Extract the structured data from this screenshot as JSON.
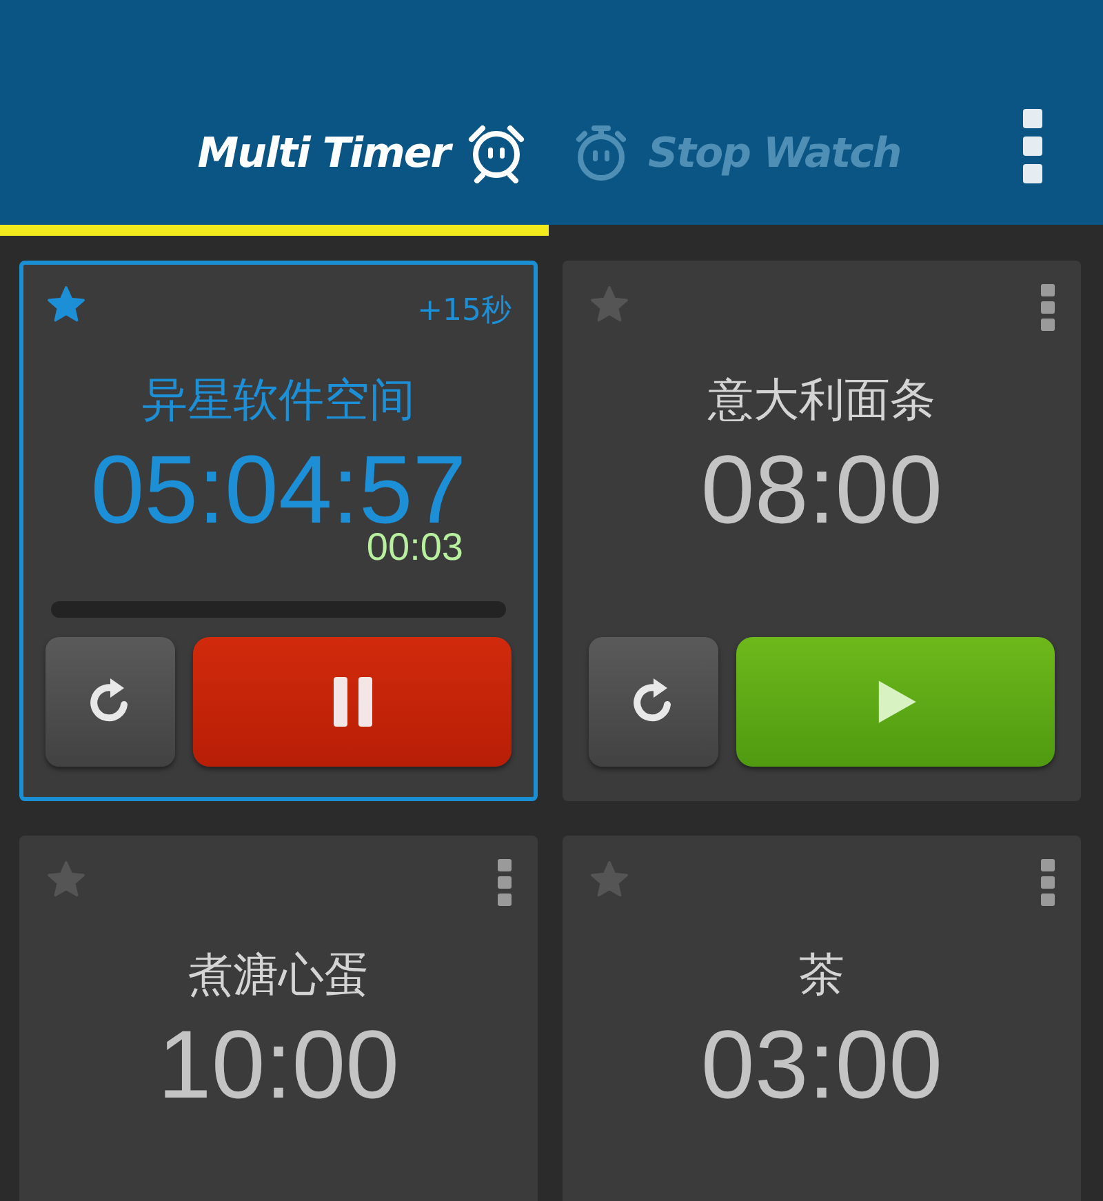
{
  "tabs": [
    {
      "label": "Multi Timer",
      "selected": true
    },
    {
      "label": "Stop Watch",
      "selected": false
    }
  ],
  "timers": [
    {
      "name": "异星软件空间",
      "time": "05:04:57",
      "favorite": true,
      "selected": true,
      "add_label": "+15秒",
      "elapsed": "00:03",
      "level": 0,
      "running": true
    },
    {
      "name": "意大利面条",
      "time": "08:00",
      "favorite": false,
      "selected": false,
      "running": false
    },
    {
      "name": "煮溏心蛋",
      "time": "10:00",
      "favorite": false,
      "selected": false
    },
    {
      "name": "茶",
      "time": "03:00",
      "favorite": false,
      "selected": false
    }
  ]
}
